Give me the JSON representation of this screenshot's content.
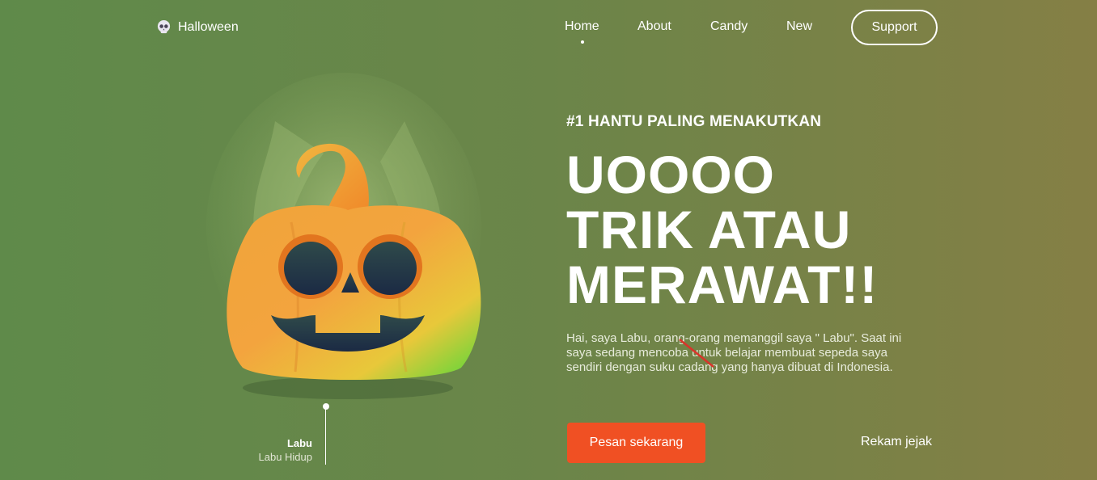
{
  "nav": {
    "logo_icon": "skull-icon",
    "logo_text": "Halloween",
    "items": [
      {
        "label": "Home",
        "active": true
      },
      {
        "label": "About",
        "active": false
      },
      {
        "label": "Candy",
        "active": false
      },
      {
        "label": "New",
        "active": false
      }
    ],
    "support_label": "Support"
  },
  "hero": {
    "eyebrow": "#1 HANTU PALING MENAKUTKAN",
    "headline_lines": [
      "UOOOO",
      "TRIK ATAU",
      "MERAWAT!!"
    ],
    "description": "Hai, saya Labu, orang-orang memanggil saya \" Labu\". Saat ini saya sedang mencoba untuk belajar membuat sepeda saya sendiri dengan suku cadang yang hanya dibuat di Indonesia.",
    "primary_cta": "Pesan sekarang",
    "secondary_cta": "Rekam jejak"
  },
  "figure": {
    "image": "jack-o-lantern-pumpkin",
    "pointer_title": "Labu",
    "pointer_subtitle": "Labu Hidup"
  },
  "colors": {
    "accent": "#f05023",
    "bg_left": "#5f8a4a",
    "bg_right": "#857f45"
  }
}
